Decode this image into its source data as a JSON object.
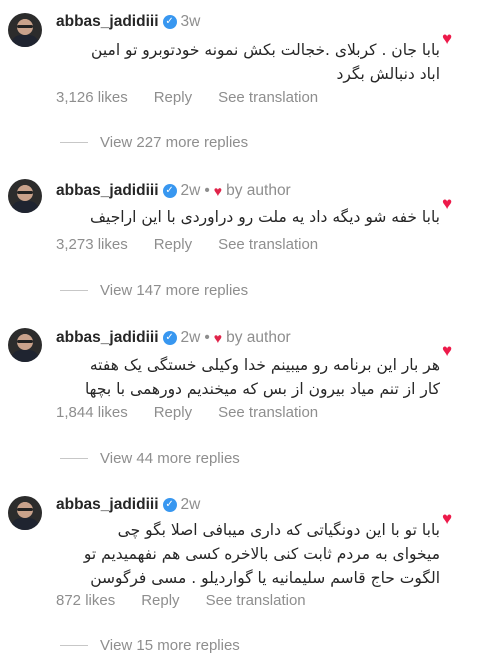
{
  "comments": [
    {
      "username": "abbas_jadidiii",
      "verified_icon": "verified-badge-icon",
      "time": "3w",
      "by_author": "",
      "text_lines": [
        "بابا جان . کربلای .خجالت بکش نمونه خودتوبرو تو امین",
        "اباد دنبالش بگرد"
      ],
      "likes": "3,126 likes",
      "reply": "Reply",
      "translate": "See translation",
      "view_replies": "View 227 more replies"
    },
    {
      "username": "abbas_jadidiii",
      "verified_icon": "verified-badge-icon",
      "time": "2w",
      "by_author": "by author",
      "text_lines": [
        "بابا خفه شو دیگه داد یه ملت رو دراوردی با این اراجیف"
      ],
      "likes": "3,273 likes",
      "reply": "Reply",
      "translate": "See translation",
      "view_replies": "View 147 more replies"
    },
    {
      "username": "abbas_jadidiii",
      "verified_icon": "verified-badge-icon",
      "time": "2w",
      "by_author": "by author",
      "text_lines": [
        "هر بار این برنامه رو میبینم خدا وکیلی خستگی یک هفته",
        "کار از تنم میاد بیرون از بس که میخندیم دورهمی با بچها"
      ],
      "likes": "1,844 likes",
      "reply": "Reply",
      "translate": "See translation",
      "view_replies": "View 44 more replies"
    },
    {
      "username": "abbas_jadidiii",
      "verified_icon": "verified-badge-icon",
      "time": "2w",
      "by_author": "",
      "text_lines": [
        "بابا تو با این دونگیاتی که داری میبافی اصلا بگو چی",
        "میخوای به مردم ثابت کنی بالاخره کسی هم نفهمیدیم تو",
        "الگوت حاج قاسم سلیمانیه یا گواردیلو . مسی فرگوسن"
      ],
      "likes": "872 likes",
      "reply": "Reply",
      "translate": "See translation",
      "view_replies": "View 15 more replies"
    }
  ],
  "colors": {
    "like_heart": "#ed1a4a",
    "verified": "#3897f0",
    "muted": "#8e8e8e"
  }
}
